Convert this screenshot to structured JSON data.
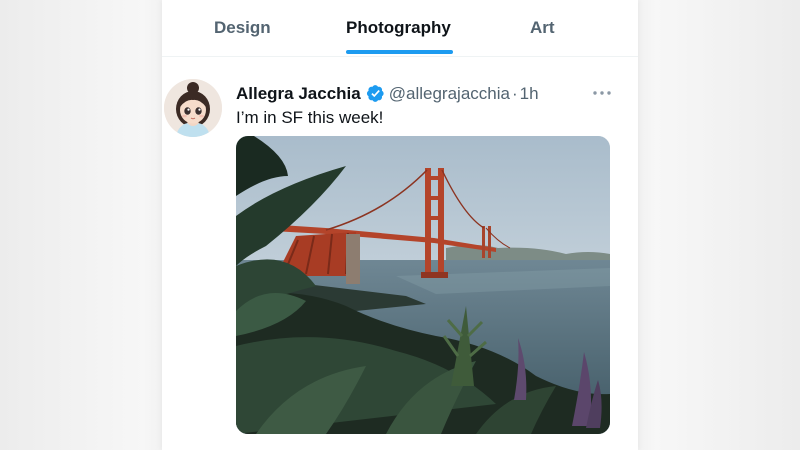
{
  "tabs": [
    {
      "label": "Design",
      "active": false
    },
    {
      "label": "Photography",
      "active": true
    },
    {
      "label": "Art",
      "active": false
    }
  ],
  "tweet": {
    "display_name": "Allegra Jacchia",
    "verified": true,
    "handle": "@allegrajacchia",
    "separator": "·",
    "time": "1h",
    "text": "I’m in SF this week!",
    "media": {
      "subject": "golden-gate-bridge-photo"
    },
    "more_icon": "more-horizontal-icon",
    "verified_icon": "verified-badge-icon"
  },
  "colors": {
    "accent": "#1d9bf0",
    "text_primary": "#0f1419",
    "text_secondary": "#536471",
    "bridge_red": "#b4442a"
  }
}
